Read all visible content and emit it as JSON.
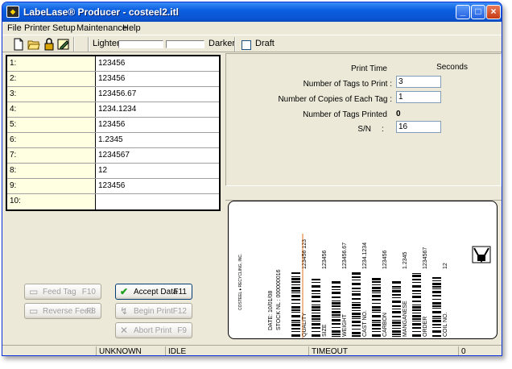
{
  "window": {
    "title": "LabeLase® Producer - costeel2.itl",
    "minimize": "_",
    "maximize": "□",
    "close": "×"
  },
  "menu": [
    "File",
    "Printer",
    "Setup",
    "Maintenance",
    "Help"
  ],
  "toolbar": {
    "lighter_label": "Lighter",
    "darker_label": "Darker",
    "draft_label": "Draft"
  },
  "fields": [
    {
      "label": "1:",
      "value": "123456"
    },
    {
      "label": "2:",
      "value": "123456"
    },
    {
      "label": "3:",
      "value": "123456.67"
    },
    {
      "label": "4:",
      "value": "1234.1234"
    },
    {
      "label": "5:",
      "value": "123456"
    },
    {
      "label": "6:",
      "value": "1.2345"
    },
    {
      "label": "7:",
      "value": "1234567"
    },
    {
      "label": "8:",
      "value": "12"
    },
    {
      "label": "9:",
      "value": "123456"
    },
    {
      "label": "10:",
      "value": ""
    }
  ],
  "buttons": {
    "feed_tag": {
      "label": "Feed Tag",
      "key": "F10"
    },
    "reverse_feed": {
      "label": "Reverse Feed",
      "key": "F8"
    },
    "accept_data": {
      "label": "Accept Data",
      "key": "F11"
    },
    "begin_print": {
      "label": "Begin Print",
      "key": "F12"
    },
    "abort_print": {
      "label": "Abort Print",
      "key": "F9"
    }
  },
  "info": {
    "print_time_label": "Print Time",
    "seconds_label": "Seconds",
    "tags_to_print_label": "Number of Tags to Print :",
    "tags_to_print_value": "3",
    "copies_label": "Number of Copies of Each Tag :",
    "copies_value": "1",
    "tags_printed_label": "Number of Tags Printed",
    "tags_printed_value": "0",
    "sn_label": "S/N",
    "sn_colon": ":",
    "sn_value": "16"
  },
  "label_preview": {
    "company": "COSTEEL ♦ RECYCLING, INC.",
    "date": "DATE: 10/01/08",
    "stock": "STOCK NL : 000000016",
    "columns": [
      {
        "name": "QUALITY",
        "value": "123456 123"
      },
      {
        "name": "SIZE",
        "value": "123456"
      },
      {
        "name": "WEIGHT",
        "value": "123456.67"
      },
      {
        "name": "CAST NO.",
        "value": "1234.1234"
      },
      {
        "name": "CARBON",
        "value": "123456"
      },
      {
        "name": "MANGANESE",
        "value": "1.2345"
      },
      {
        "name": "ORDER",
        "value": "1234567"
      },
      {
        "name": "COIL NO.",
        "value": "12"
      }
    ]
  },
  "status": {
    "mode": "UNKNOWN MODE",
    "state": "IDLE",
    "timeout": "TIMEOUT",
    "count": "0"
  }
}
